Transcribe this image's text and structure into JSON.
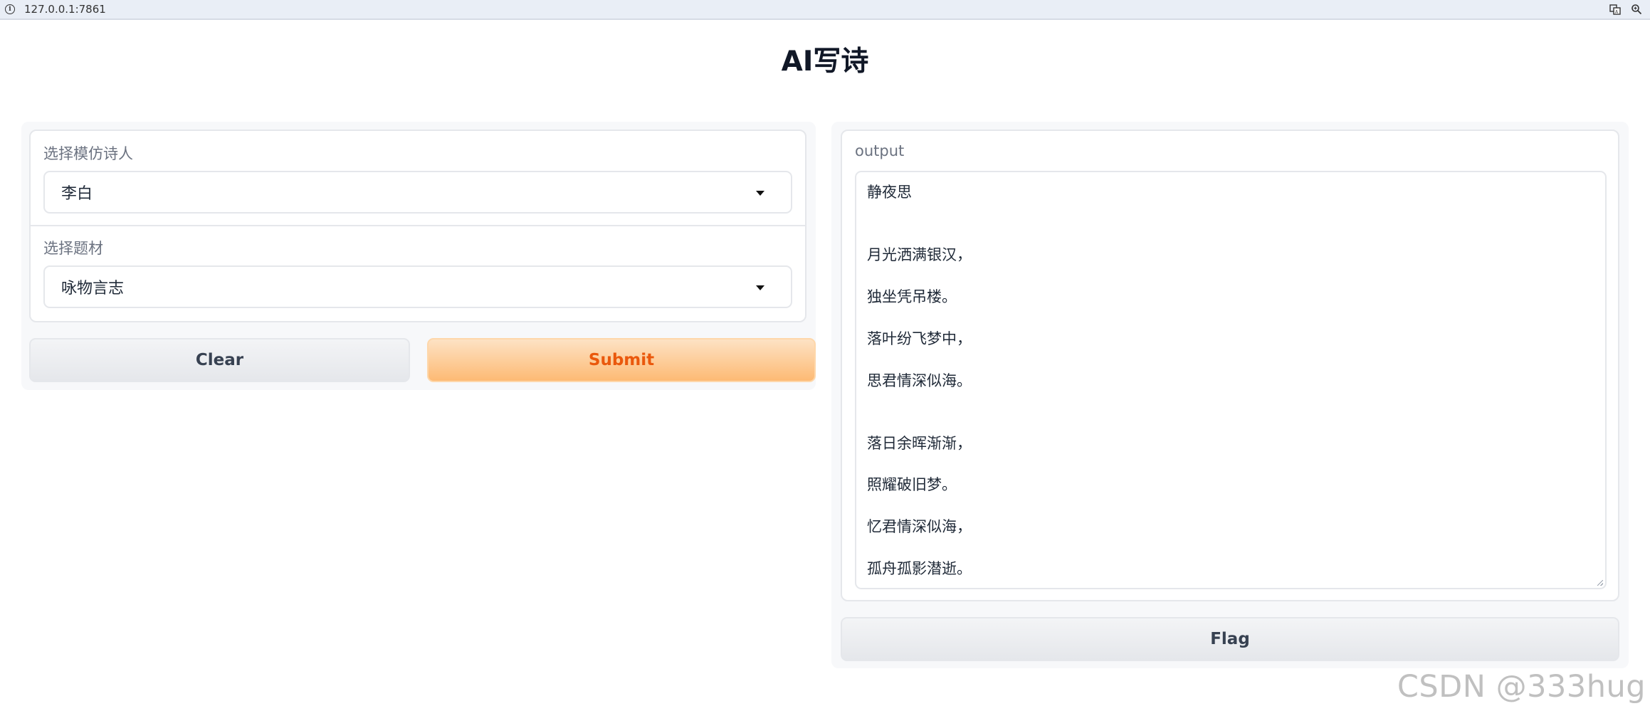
{
  "browser": {
    "url": "127.0.0.1:7861",
    "icons": [
      "info-icon",
      "translate-icon",
      "zoom-icon"
    ]
  },
  "page": {
    "title": "AI写诗"
  },
  "inputs": {
    "poet_label": "选择模仿诗人",
    "poet_value": "李白",
    "theme_label": "选择题材",
    "theme_value": "咏物言志"
  },
  "actions": {
    "clear_label": "Clear",
    "submit_label": "Submit",
    "flag_label": "Flag"
  },
  "output": {
    "label": "output",
    "lines": [
      "静夜思",
      "",
      "",
      "月光洒满银汉，",
      "",
      "独坐凭吊楼。",
      "",
      "落叶纷飞梦中，",
      "",
      "思君情深似海。",
      "",
      "",
      "落日余晖渐渐，",
      "",
      "照耀破旧梦。",
      "",
      "忆君情深似海，",
      "",
      "孤舟孤影潜逝。"
    ]
  },
  "watermark": "CSDN @333hug",
  "colors": {
    "primary_text": "#ea580c",
    "primary_bg": "#fdba74",
    "secondary_bg": "#e5e7eb",
    "label": "#6b7280"
  }
}
